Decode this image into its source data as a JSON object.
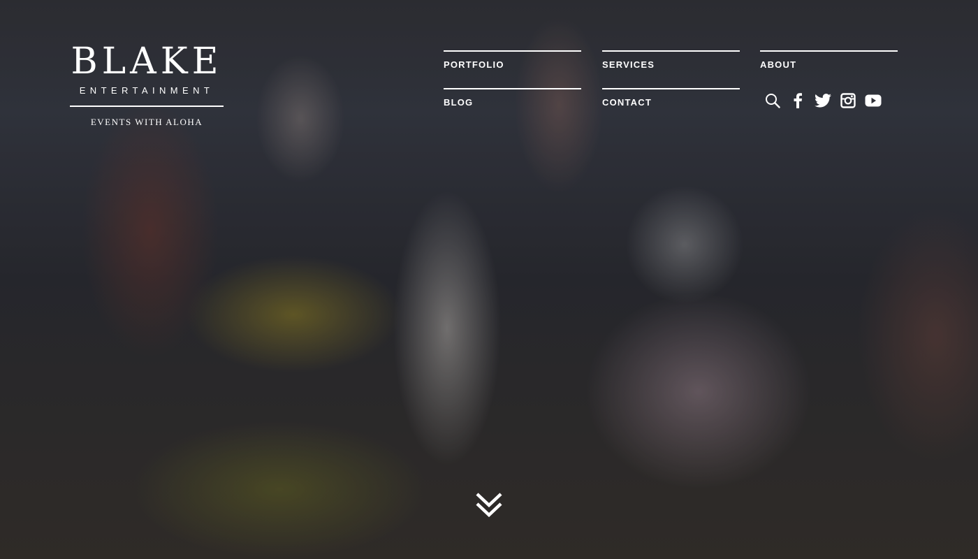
{
  "logo": {
    "wordmark": "BLAKE",
    "subtitle": "ENTERTAINMENT",
    "tagline": "EVENTS WITH ALOHA"
  },
  "nav": {
    "portfolio": "PORTFOLIO",
    "services": "SERVICES",
    "about": "ABOUT",
    "blog": "BLOG",
    "contact": "CONTACT"
  },
  "social": {
    "icons": [
      "search-icon",
      "facebook-icon",
      "twitter-icon",
      "instagram-icon",
      "youtube-icon"
    ]
  },
  "hero": {
    "scroll_icon": "double-chevron-down-icon"
  },
  "colors": {
    "text": "#ffffff",
    "overlay": "#000000"
  }
}
